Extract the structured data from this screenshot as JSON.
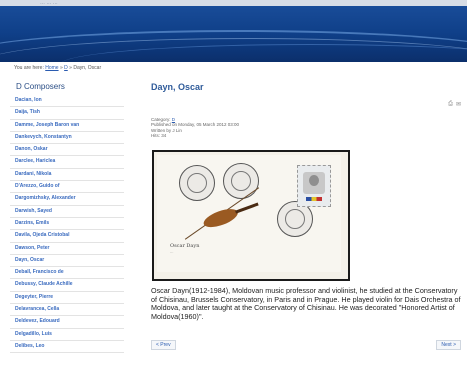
{
  "banner": {
    "topline": "… … …"
  },
  "breadcrumb": {
    "prefix": "You are here:",
    "home": "Home",
    "sep1": "»",
    "letter": "D",
    "sep2": "»",
    "current": "Dayn, Oscar"
  },
  "sidebar": {
    "heading": "D Composers",
    "items": [
      "Dacian, Ion",
      "Daija, Tish",
      "Damme, Joseph Baron van",
      "Dankevych, Konstantyn",
      "Danon, Oskar",
      "Darclee, Hariclea",
      "Dardani, Nikola",
      "D'Arezzo, Guido of",
      "Dargomizhsky, Alexander",
      "Darwish, Sayed",
      "Darzins, Emils",
      "Davila, Ojeda Cristobal",
      "Dawson, Peter",
      "Dayn, Oscar",
      "Deball, Francisco de",
      "Debussy, Claude Achille",
      "Degeyter, Pierre",
      "Delavrancea, Cella",
      "Deldevez, Edouard",
      "Delgadillo, Luis",
      "Delibes, Leo"
    ]
  },
  "article": {
    "title": "Dayn, Oscar",
    "category_label": "Category:",
    "category_value": "D",
    "published": "Published on Monday, 05 March 2012 03:00",
    "written": "Written by J Lin",
    "hits": "Hits: 34",
    "envelope_name": "Oscar Dayn",
    "envelope_sub": "…",
    "bio": "Oscar Dayn(1912-1984), Moldovan music professor and violinist, he studied at the Conservatory of Chisinau, Brussels Conservatory, in Paris and in Prague. He played violin for Dais Orchestra of Moldova, and later taught at the Conservatory of Chisinau. He was decorated \"Honored Artist of Moldova(1960)\".",
    "prev": "< Prev",
    "next": "Next >"
  },
  "icons": [
    "print-icon",
    "email-icon"
  ]
}
